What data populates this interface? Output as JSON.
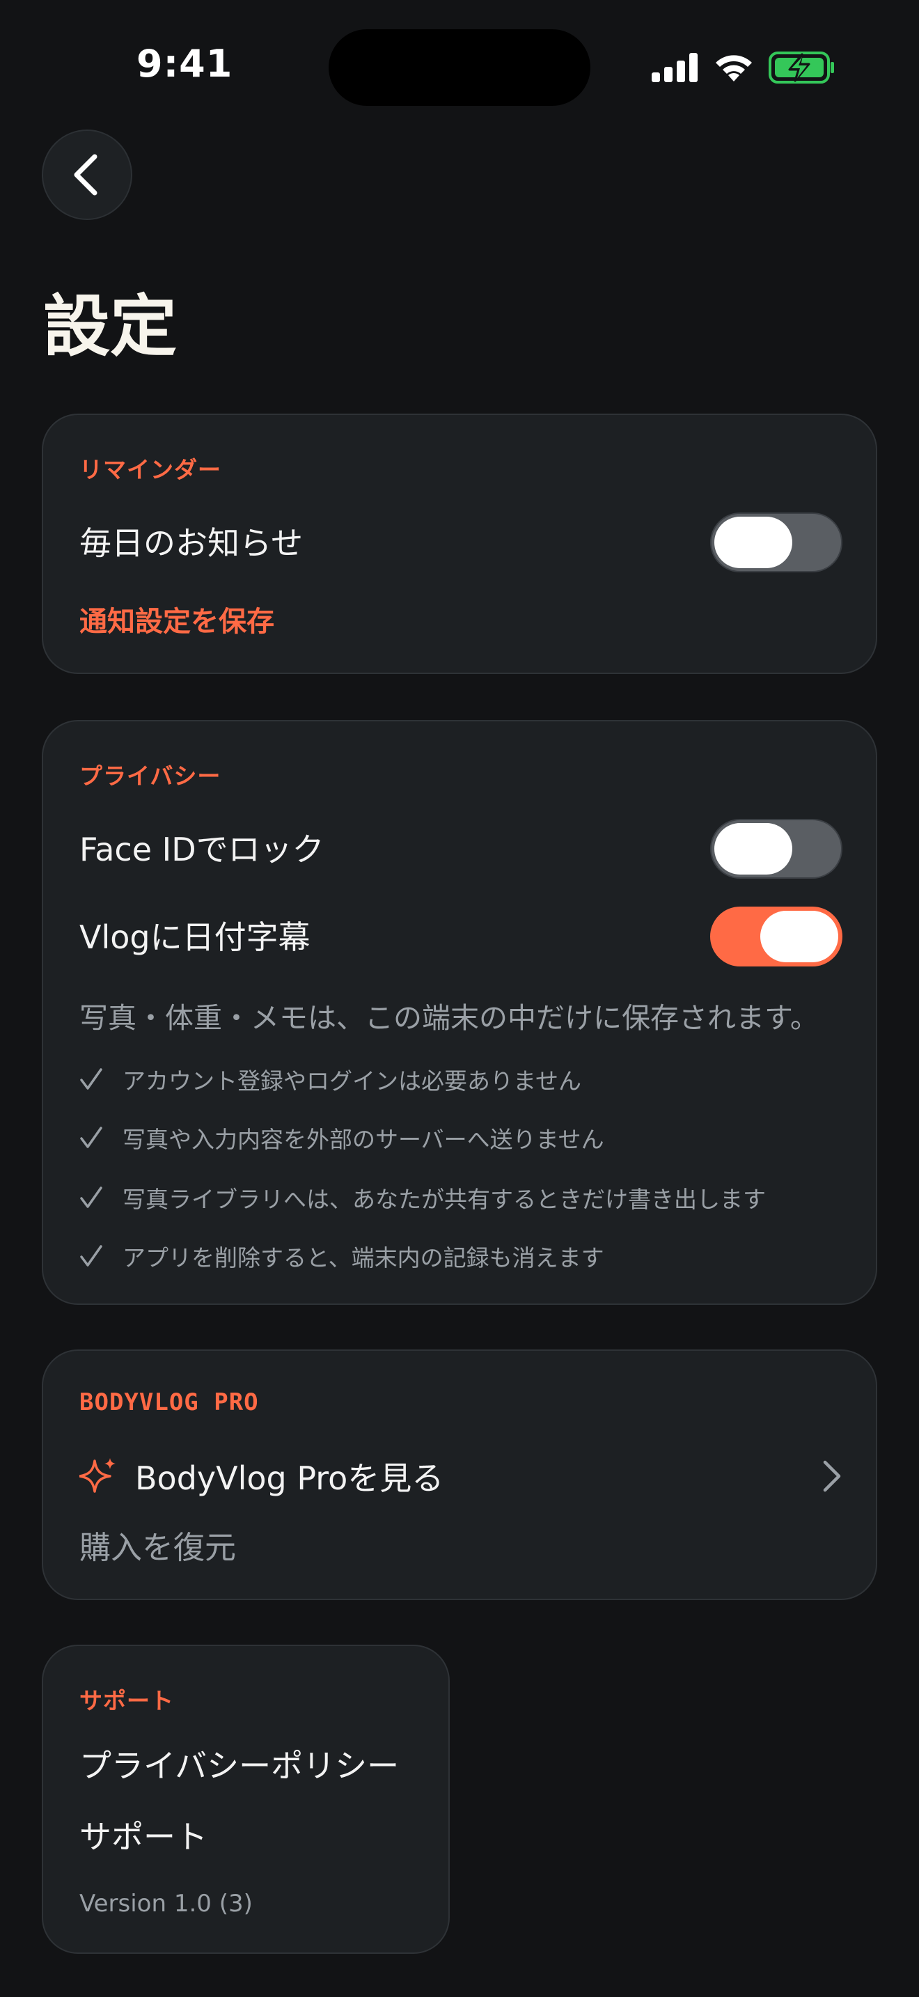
{
  "status_bar": {
    "time": "9:41"
  },
  "header": {
    "title": "設定"
  },
  "reminder": {
    "section_label": "リマインダー",
    "daily_notification_label": "毎日のお知らせ",
    "daily_notification_on": false,
    "save_label": "通知設定を保存"
  },
  "privacy": {
    "section_label": "プライバシー",
    "face_id_label": "Face IDでロック",
    "face_id_on": false,
    "vlog_caption_label": "Vlogに日付字幕",
    "vlog_caption_on": true,
    "description": "写真・体重・メモは、この端末の中だけに保存されます。",
    "points": [
      "アカウント登録やログインは必要ありません",
      "写真や入力内容を外部のサーバーへ送りません",
      "写真ライブラリへは、あなたが共有するときだけ書き出します",
      "アプリを削除すると、端末内の記録も消えます"
    ]
  },
  "pro": {
    "section_label": "BODYVLOG PRO",
    "view_label": "BodyVlog Proを見る",
    "restore_label": "購入を復元"
  },
  "support": {
    "section_label": "サポート",
    "privacy_policy_label": "プライバシーポリシー",
    "support_label": "サポート",
    "version": "Version 1.0 (3)"
  },
  "colors": {
    "accent": "#ff6a45",
    "background": "#121315",
    "card": "#1d2023",
    "battery": "#34c759"
  },
  "icons": {
    "back": "chevron-left-icon",
    "pro": "sparkle-icon",
    "pro_chevron": "chevron-right-icon",
    "check": "checkmark-icon"
  }
}
